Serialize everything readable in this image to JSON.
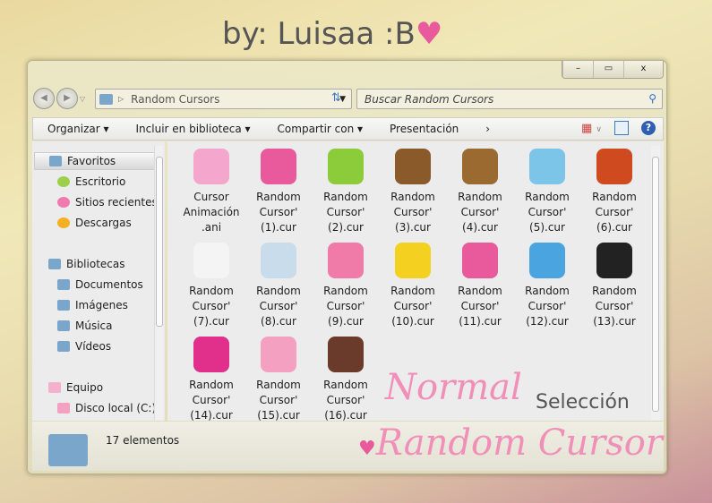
{
  "signature": "by: Luisaa :B",
  "window": {
    "minimize": "–",
    "maximize": "▭",
    "close": "x"
  },
  "address": {
    "path": "Random Cursors",
    "search_placeholder": "Buscar Random Cursors"
  },
  "toolbar": {
    "organize": "Organizar ▾",
    "include": "Incluir en biblioteca ▾",
    "share": "Compartir con ▾",
    "presentation": "Presentación",
    "more": "›"
  },
  "nav": {
    "favorites": "Favoritos",
    "items_fav": [
      "Escritorio",
      "Sitios recientes",
      "Descargas"
    ],
    "libraries": "Bibliotecas",
    "items_lib": [
      "Documentos",
      "Imágenes",
      "Música",
      "Vídeos"
    ],
    "computer": "Equipo",
    "items_comp": [
      "Disco local (C:)"
    ]
  },
  "files": [
    "Cursor Animación .ani",
    "Random Cursor' (1).cur",
    "Random Cursor' (2).cur",
    "Random Cursor' (3).cur",
    "Random Cursor' (4).cur",
    "Random Cursor' (5).cur",
    "Random Cursor' (6).cur",
    "Random Cursor' (7).cur",
    "Random Cursor' (8).cur",
    "Random Cursor' (9).cur",
    "Random Cursor' (10).cur",
    "Random Cursor' (11).cur",
    "Random Cursor' (12).cur",
    "Random Cursor' (13).cur",
    "Random Cursor' (14).cur",
    "Random Cursor' (15).cur",
    "Random Cursor' (16).cur"
  ],
  "file_colors": [
    "#f4a6cc",
    "#e85a9c",
    "#8ccc3a",
    "#8a5a2a",
    "#9a6a30",
    "#7cc4e8",
    "#d04a20",
    "#f4f4f4",
    "#c8dcec",
    "#f07aa8",
    "#f4d020",
    "#e85a9c",
    "#4aa4e0",
    "#222222",
    "#e0308c",
    "#f4a0c0",
    "#6a3a2a"
  ],
  "status": "17 elementos",
  "overlay": {
    "normal": "Normal",
    "selection": "Selección",
    "title": "Random Cursor"
  }
}
